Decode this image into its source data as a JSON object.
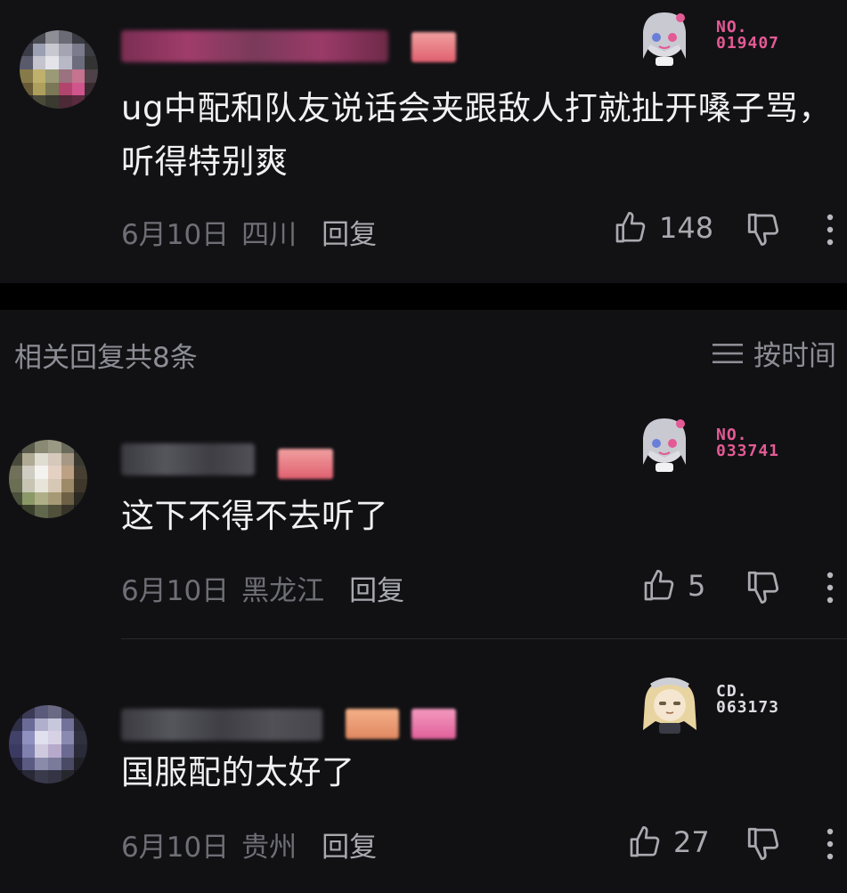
{
  "colors": {
    "background": "#111114",
    "separator": "#000000",
    "text_primary": "#f1f1f4",
    "text_meta": "#6e6e76",
    "reply_action": "#a9a9b0",
    "sticker_pink": "#e45a95",
    "sticker_light": "#dcdce2"
  },
  "main_comment": {
    "text": "ug中配和队友说话会夹跟敌人打就扯开嗓子骂，听得特别爽",
    "date": "6月10日",
    "location": "四川",
    "reply_label": "回复",
    "likes": "148",
    "sticker": {
      "icon": "anime-girl-sticker-icon",
      "line1": "NO.",
      "line2": "019407"
    }
  },
  "replies_section": {
    "title": "相关回复共8条",
    "sort_label": "按时间"
  },
  "replies": [
    {
      "text": "这下不得不去听了",
      "date": "6月10日",
      "location": "黑龙江",
      "reply_label": "回复",
      "likes": "5",
      "sticker": {
        "icon": "anime-girl-sticker-icon",
        "line1": "NO.",
        "line2": "033741"
      }
    },
    {
      "text": "国服配的太好了",
      "date": "6月10日",
      "location": "贵州",
      "reply_label": "回复",
      "likes": "27",
      "sticker": {
        "icon": "blonde-girl-sticker-icon",
        "line1": "CD.",
        "line2": "063173"
      }
    }
  ]
}
